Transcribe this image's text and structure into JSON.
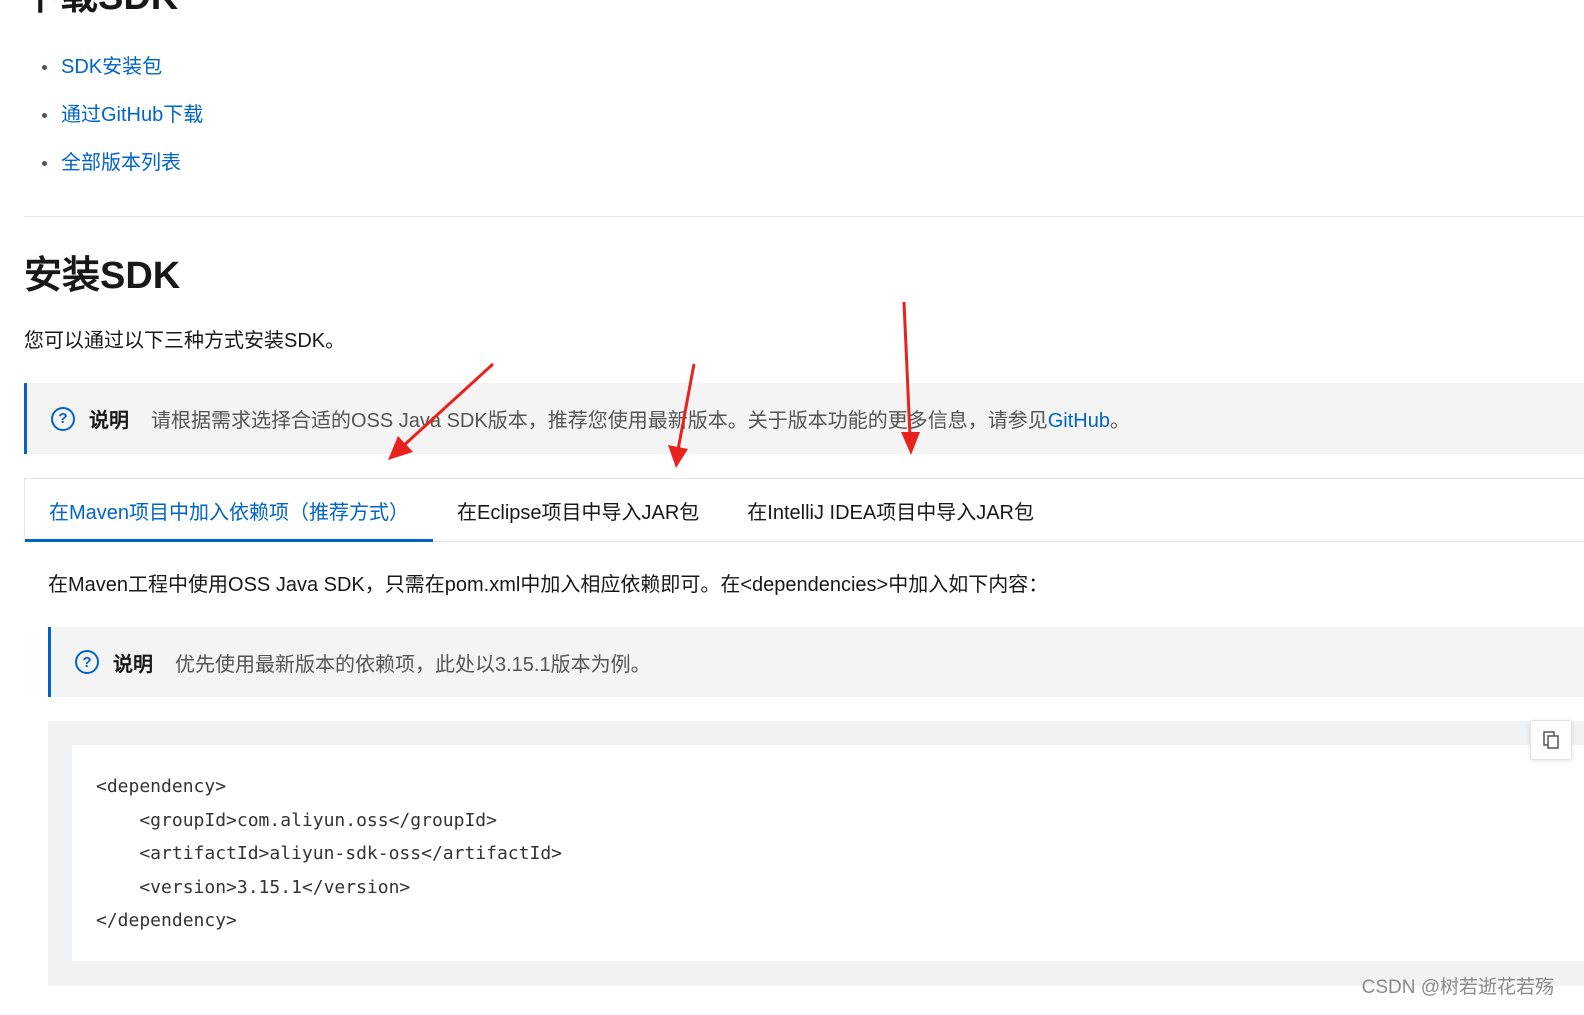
{
  "download_section": {
    "heading": "下载SDK",
    "links": [
      {
        "label": "SDK安装包"
      },
      {
        "label": "通过GitHub下载"
      },
      {
        "label": "全部版本列表"
      }
    ]
  },
  "install_section": {
    "heading": "安装SDK",
    "intro": "您可以通过以下三种方式安装SDK。",
    "note": {
      "label": "说明",
      "text": "请根据需求选择合适的OSS Java SDK版本，推荐您使用最新版本。关于版本功能的更多信息，请参见",
      "link": "GitHub",
      "suffix": "。"
    }
  },
  "tabs": [
    {
      "label": "在Maven项目中加入依赖项（推荐方式）",
      "active": true
    },
    {
      "label": "在Eclipse项目中导入JAR包",
      "active": false
    },
    {
      "label": "在IntelliJ IDEA项目中导入JAR包",
      "active": false
    }
  ],
  "maven_tab": {
    "description": "在Maven工程中使用OSS Java SDK，只需在pom.xml中加入相应依赖即可。在<dependencies>中加入如下内容：",
    "note": {
      "label": "说明",
      "text": "优先使用最新版本的依赖项，此处以3.15.1版本为例。"
    },
    "code_lines": [
      "<dependency>",
      "    <groupId>com.aliyun.oss</groupId>",
      "    <artifactId>aliyun-sdk-oss</artifactId>",
      "    <version>3.15.1</version>",
      "</dependency>"
    ]
  },
  "icons": {
    "note": "question-circle-icon",
    "copy": "copy-icon"
  },
  "colors": {
    "link": "#0064c8",
    "annotation_arrow": "#e8231f",
    "note_background": "#f4f4f4"
  },
  "watermark": "CSDN @树若逝花若殇"
}
